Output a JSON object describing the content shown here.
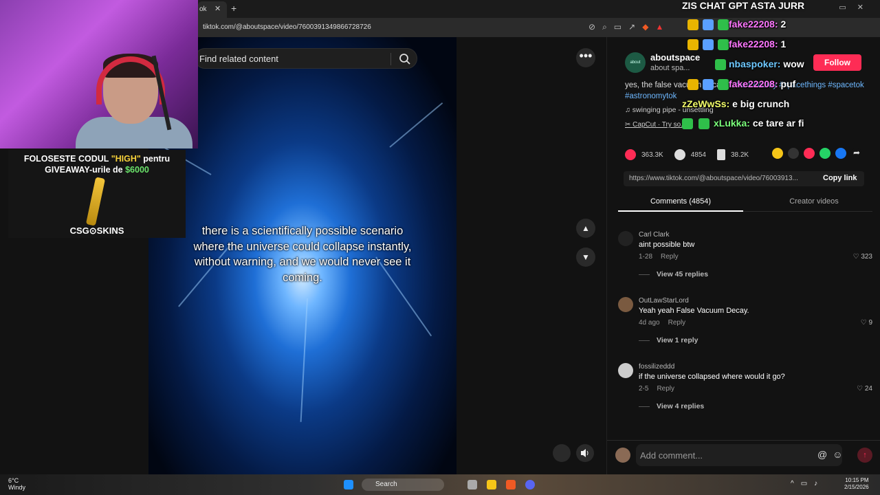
{
  "browser": {
    "tab_label": "ok",
    "url": "tiktok.com/@aboutspace/video/7600391349866728726"
  },
  "tiktok": {
    "search_placeholder": "Find related content",
    "video_caption": "there is a scientifically possible scenario where the universe could collapse instantly, without warning, and we would never see it coming.",
    "author": {
      "name": "aboutspace",
      "sub": "about spa..."
    },
    "follow_label": "Follow",
    "description_text": "yes, the false vacuum decay ... ",
    "description_tags": "#astronomy #spacethings #spacetok #astronomytok",
    "music": "swinging pipe - unsettling",
    "capcut": "CapCut · Try so...",
    "actions": {
      "likes": "363.3K",
      "comments": "4854",
      "saves": "38.2K"
    },
    "share_link": "https://www.tiktok.com/@aboutspace/video/76003913...",
    "copy_link_label": "Copy link",
    "tabs": {
      "comments": "Comments (4854)",
      "creator": "Creator videos"
    },
    "comments": [
      {
        "user": "Carl Clark",
        "text": "aint possible btw",
        "date": "1-28",
        "reply": "Reply",
        "likes": "323",
        "view": "View 45 replies"
      },
      {
        "user": "OutLawStarLord",
        "text": "Yeah yeah False Vacuum Decay.",
        "date": "4d ago",
        "reply": "Reply",
        "likes": "9",
        "view": "View 1 reply"
      },
      {
        "user": "fossilizeddd",
        "text": "if the universe collapsed where would it go?",
        "date": "2-5",
        "reply": "Reply",
        "likes": "24",
        "view": "View 4 replies"
      }
    ],
    "add_comment_placeholder": "Add comment..."
  },
  "stream": {
    "promo_line1": "FOLOSESTE CODUL",
    "promo_code": "\"HIGH\"",
    "promo_line1_end": "pentru",
    "promo_line2": "GIVEAWAY-urile de",
    "promo_amount": "$6000",
    "brand": "CSG⊙SKINS",
    "chat_title": "ZIS CHAT GPT ASTA JURR",
    "chat": [
      {
        "name": "fake22208:",
        "msg": "2",
        "color": "pink"
      },
      {
        "name": "fake22208:",
        "msg": "1",
        "color": "pink"
      },
      {
        "name": "nbaspoker:",
        "msg": "wow",
        "color": "blue"
      },
      {
        "name": "fake22208:",
        "msg": "puf",
        "color": "pink"
      },
      {
        "name": "zZeWwSs:",
        "msg": "e big crunch",
        "color": "yellow"
      },
      {
        "name": "xLukka:",
        "msg": "ce tare ar fi",
        "color": "green"
      }
    ]
  },
  "taskbar": {
    "temp": "6°C",
    "weather": "Windy",
    "search": "Search",
    "time": "10:15 PM",
    "date": "2/15/2026"
  }
}
